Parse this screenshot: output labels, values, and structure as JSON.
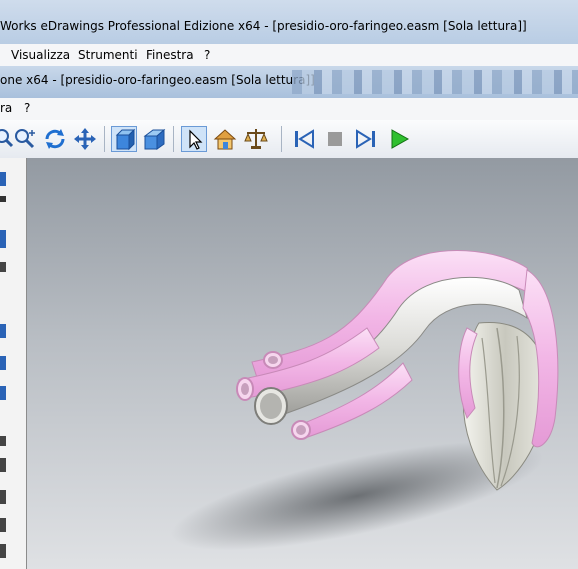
{
  "window": {
    "title": "Works eDrawings Professional Edizione x64 - [presidio-oro-faringeo.easm [Sola lettura]]"
  },
  "main_menu": {
    "items": [
      {
        "label": "Visualizza"
      },
      {
        "label": "Strumenti"
      },
      {
        "label": "Finestra"
      },
      {
        "label": "?"
      }
    ]
  },
  "document": {
    "title": "one x64 - [presidio-oro-faringeo.easm [Sola lettura]]"
  },
  "doc_menu": {
    "items": [
      {
        "label": "ra"
      },
      {
        "label": "?"
      }
    ]
  },
  "toolbar": {
    "buttons": [
      {
        "icon": "zoom-area-icon"
      },
      {
        "icon": "zoom-icon"
      },
      {
        "icon": "rotate-icon"
      },
      {
        "icon": "pan-icon"
      },
      {
        "icon": "shaded-view-icon",
        "pressed": true
      },
      {
        "icon": "perspective-icon"
      },
      {
        "icon": "select-arrow-icon",
        "pressed": true
      },
      {
        "icon": "home-view-icon"
      },
      {
        "icon": "measure-icon"
      },
      {
        "icon": "first-frame-icon"
      },
      {
        "icon": "stop-icon"
      },
      {
        "icon": "last-frame-icon"
      },
      {
        "icon": "play-icon"
      }
    ]
  },
  "colors": {
    "pink_tube": "#f2b6e6",
    "gray_tube": "#d8d8d4",
    "viewport_top": "#939aa2",
    "viewport_bottom": "#dfe1e4"
  }
}
